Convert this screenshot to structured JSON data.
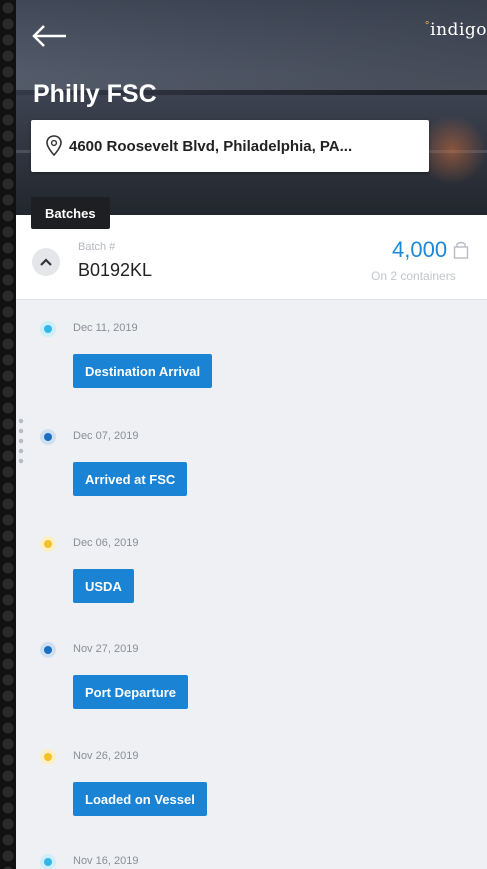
{
  "header": {
    "title": "Philly FSC",
    "brand": "indigo",
    "address": "4600 Roosevelt Blvd, Philadelphia, PA...",
    "tab_label": "Batches"
  },
  "batch": {
    "label": "Batch #",
    "id": "B0192KL",
    "quantity": "4,000",
    "containers": "On 2 containers"
  },
  "timeline": [
    {
      "date": "Dec 11, 2019",
      "event": "Destination Arrival",
      "dot_color": "#35b6e8"
    },
    {
      "date": "Dec 07, 2019",
      "event": "Arrived at FSC",
      "dot_color": "#1a6fc2"
    },
    {
      "date": "Dec 06, 2019",
      "event": "USDA",
      "dot_color": "#f4c02b"
    },
    {
      "date": "Nov 27, 2019",
      "event": "Port Departure",
      "dot_color": "#1a6fc2"
    },
    {
      "date": "Nov 26, 2019",
      "event": "Loaded on Vessel",
      "dot_color": "#f4c02b"
    },
    {
      "date": "Nov 16, 2019",
      "event": "",
      "dot_color": "#35b6e8"
    }
  ],
  "colors": {
    "accent": "#1a83d4",
    "quantity": "#1e88d8"
  }
}
